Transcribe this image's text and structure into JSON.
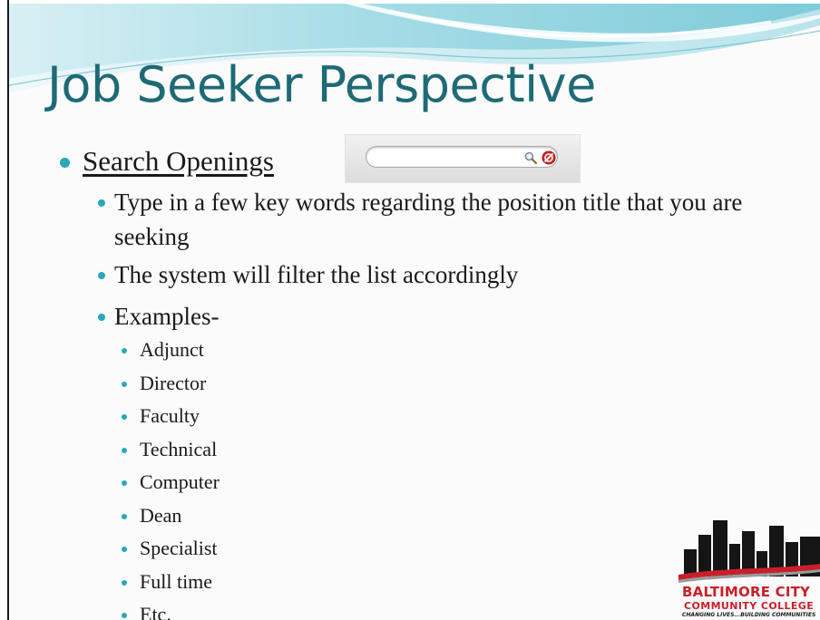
{
  "slide": {
    "title": "Job Seeker Perspective",
    "heading": "Search Openings",
    "search": {
      "value": "",
      "search_icon": "magnifier-icon",
      "clear_icon": "clear-icon"
    },
    "points": [
      "Type in a few key words regarding the position title that you are seeking",
      "The system will filter the list accordingly",
      "Examples-"
    ],
    "examples": [
      "Adjunct",
      "Director",
      "Faculty",
      "Technical",
      "Computer",
      "Dean",
      "Specialist",
      "Full time",
      "Etc."
    ]
  },
  "logo": {
    "line1": "BALTIMORE CITY",
    "line2": "COMMUNITY COLLEGE",
    "tagline": "CHANGING LIVES...BUILDING COMMUNITIES"
  },
  "colors": {
    "title": "#1e6a76",
    "bullet": "#2aa7b8",
    "wave": "#9fd9e2",
    "logo_red": "#c8202a"
  }
}
